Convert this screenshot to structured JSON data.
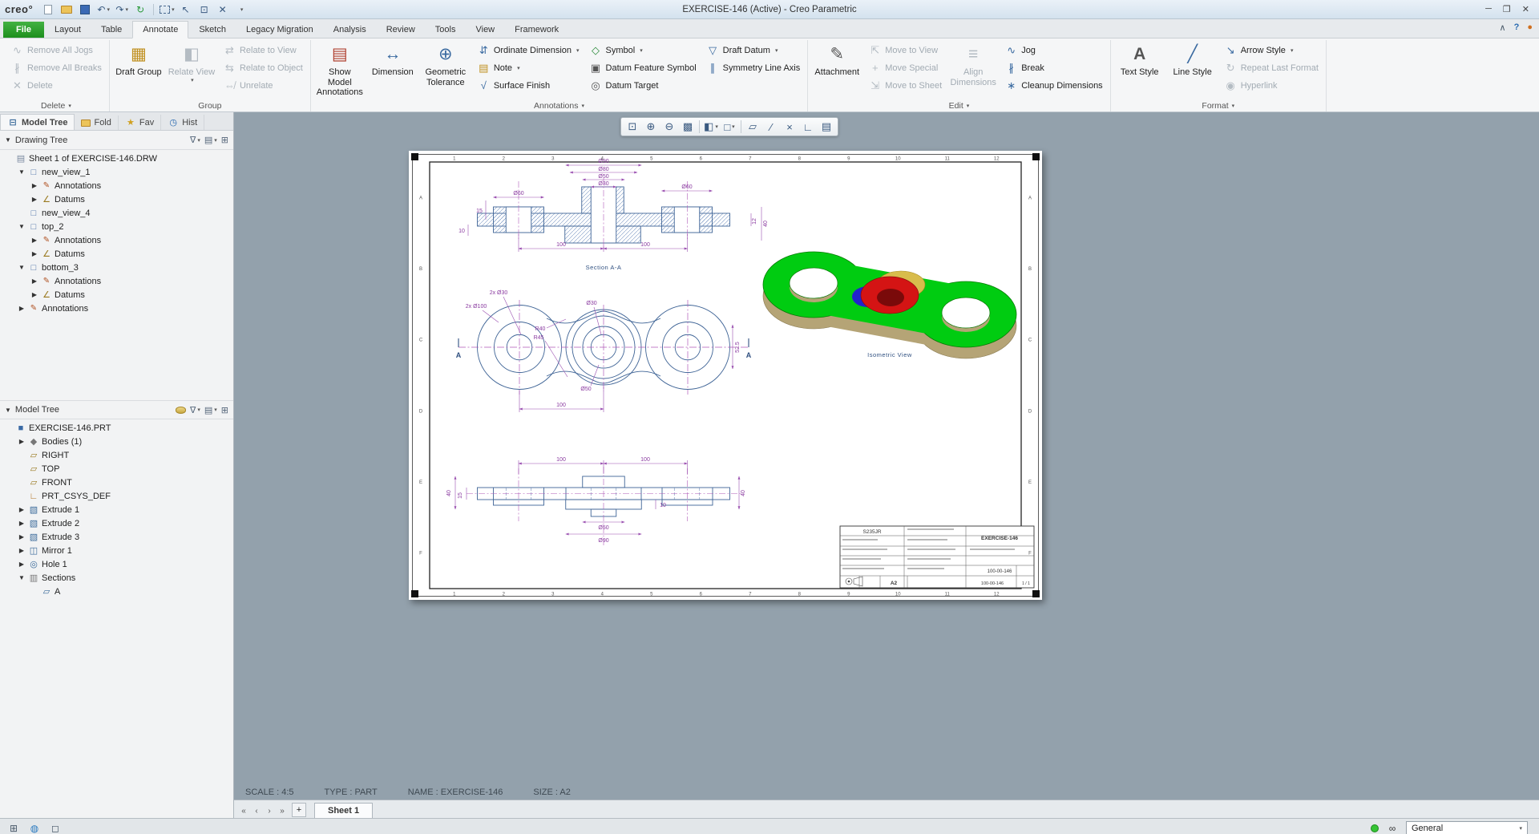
{
  "titlebar": {
    "logo": "creo°",
    "title": "EXERCISE-146 (Active) - Creo Parametric"
  },
  "tabs": {
    "items": [
      "File",
      "Layout",
      "Table",
      "Annotate",
      "Sketch",
      "Legacy Migration",
      "Analysis",
      "Review",
      "Tools",
      "View",
      "Framework"
    ],
    "active": "Annotate"
  },
  "ribbon": {
    "delete": {
      "label": "Delete",
      "jogs": "Remove All Jogs",
      "breaks": "Remove All Breaks",
      "del": "Delete"
    },
    "group": {
      "label": "Group",
      "draft": "Draft Group",
      "relate_view": "Relate View",
      "to_view": "Relate to View",
      "to_object": "Relate to Object",
      "unrelate": "Unrelate"
    },
    "annotations": {
      "label": "Annotations",
      "show_model": "Show Model Annotations",
      "dimension": "Dimension",
      "geom_tol": "Geometric Tolerance",
      "ordinate": "Ordinate Dimension",
      "note": "Note",
      "surface": "Surface Finish",
      "symbol": "Symbol",
      "datum_feature": "Datum Feature Symbol",
      "datum_target": "Datum Target",
      "draft_datum": "Draft Datum",
      "symmetry": "Symmetry Line Axis"
    },
    "edit": {
      "label": "Edit",
      "attachment": "Attachment",
      "move_view": "Move to View",
      "move_special": "Move Special",
      "move_sheet": "Move to Sheet",
      "align": "Align Dimensions",
      "jog": "Jog",
      "brk": "Break",
      "cleanup": "Cleanup Dimensions"
    },
    "format": {
      "label": "Format",
      "text_style": "Text Style",
      "line_style": "Line Style",
      "arrow_style": "Arrow Style",
      "repeat": "Repeat Last Format",
      "hyperlink": "Hyperlink"
    }
  },
  "panel": {
    "tabs": {
      "model_tree": "Model Tree",
      "folders": "Fold",
      "favorites": "Fav",
      "history": "Hist"
    },
    "drawing_tree": {
      "title": "Drawing Tree",
      "items": [
        {
          "label": "Sheet 1 of EXERCISE-146.DRW"
        },
        {
          "label": "new_view_1"
        },
        {
          "label": "Annotations"
        },
        {
          "label": "Datums"
        },
        {
          "label": "new_view_4"
        },
        {
          "label": "top_2"
        },
        {
          "label": "Annotations"
        },
        {
          "label": "Datums"
        },
        {
          "label": "bottom_3"
        },
        {
          "label": "Annotations"
        },
        {
          "label": "Datums"
        },
        {
          "label": "Annotations"
        }
      ]
    },
    "model_tree": {
      "title": "Model Tree",
      "items": [
        {
          "label": "EXERCISE-146.PRT"
        },
        {
          "label": "Bodies (1)"
        },
        {
          "label": "RIGHT"
        },
        {
          "label": "TOP"
        },
        {
          "label": "FRONT"
        },
        {
          "label": "PRT_CSYS_DEF"
        },
        {
          "label": "Extrude 1"
        },
        {
          "label": "Extrude 2"
        },
        {
          "label": "Extrude 3"
        },
        {
          "label": "Mirror 1"
        },
        {
          "label": "Hole 1"
        },
        {
          "label": "Sections"
        },
        {
          "label": "A"
        }
      ]
    }
  },
  "graphics": {
    "status": {
      "scale": "SCALE : 4:5",
      "type": "TYPE : PART",
      "name": "NAME : EXERCISE-146",
      "size": "SIZE : A2"
    },
    "sheet_tab": "Sheet 1",
    "add_sheet": "+",
    "filter": "General"
  },
  "sheet": {
    "zones_h": [
      "1",
      "2",
      "3",
      "4",
      "5",
      "6",
      "7",
      "8",
      "9",
      "10",
      "11",
      "12"
    ],
    "zones_v": [
      "A",
      "B",
      "C",
      "D",
      "E",
      "F"
    ],
    "section_view": {
      "d90": "Ø90",
      "d80": "Ø80",
      "d50": "Ø50",
      "d30": "Ø30",
      "d60l": "Ø60",
      "d60r": "Ø60",
      "w100l": "100",
      "w100r": "100",
      "t15": "15",
      "t10": "10",
      "t40": "40",
      "t12": "12",
      "label": "Section A-A"
    },
    "plan_view": {
      "holes": "2x Ø30",
      "outer": "2x Ø100",
      "r40": "R40",
      "r45": "R45",
      "d30": "Ø30",
      "d50": "Ø50",
      "h525": "52.5",
      "w100": "100",
      "cut": "A"
    },
    "bottom_view": {
      "w100l": "100",
      "w100r": "100",
      "d50": "Ø50",
      "d90": "Ø90",
      "t40l": "40",
      "t15": "15",
      "t10": "10",
      "t40r": "40"
    },
    "iso_label": "Isometric View",
    "titleblock": {
      "material": "S235JR",
      "title": "EXERCISE-146",
      "code": "100-00-146",
      "size": "A2",
      "code2": "100-00-146",
      "sheet": "1 / 1"
    }
  }
}
